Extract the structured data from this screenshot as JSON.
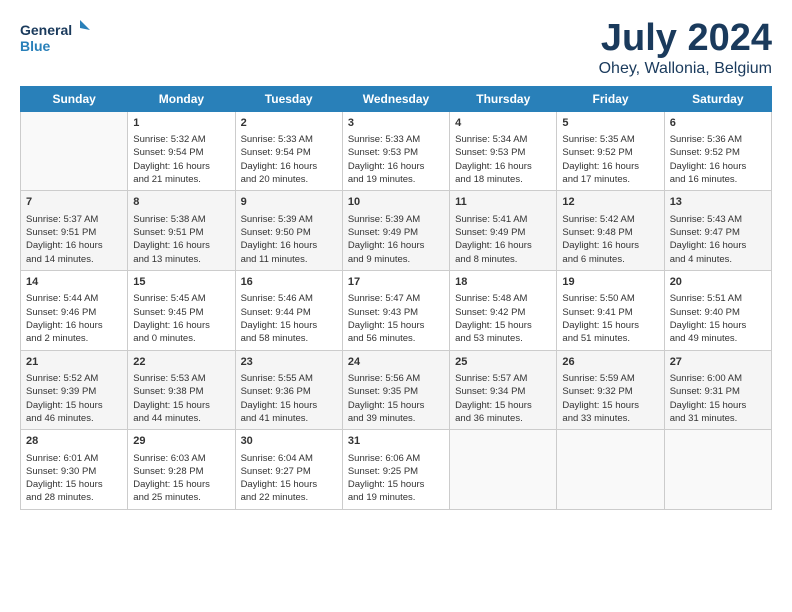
{
  "header": {
    "logo_line1": "General",
    "logo_line2": "Blue",
    "title": "July 2024",
    "subtitle": "Ohey, Wallonia, Belgium"
  },
  "days_of_week": [
    "Sunday",
    "Monday",
    "Tuesday",
    "Wednesday",
    "Thursday",
    "Friday",
    "Saturday"
  ],
  "weeks": [
    [
      {
        "day": "",
        "info": ""
      },
      {
        "day": "1",
        "info": "Sunrise: 5:32 AM\nSunset: 9:54 PM\nDaylight: 16 hours\nand 21 minutes."
      },
      {
        "day": "2",
        "info": "Sunrise: 5:33 AM\nSunset: 9:54 PM\nDaylight: 16 hours\nand 20 minutes."
      },
      {
        "day": "3",
        "info": "Sunrise: 5:33 AM\nSunset: 9:53 PM\nDaylight: 16 hours\nand 19 minutes."
      },
      {
        "day": "4",
        "info": "Sunrise: 5:34 AM\nSunset: 9:53 PM\nDaylight: 16 hours\nand 18 minutes."
      },
      {
        "day": "5",
        "info": "Sunrise: 5:35 AM\nSunset: 9:52 PM\nDaylight: 16 hours\nand 17 minutes."
      },
      {
        "day": "6",
        "info": "Sunrise: 5:36 AM\nSunset: 9:52 PM\nDaylight: 16 hours\nand 16 minutes."
      }
    ],
    [
      {
        "day": "7",
        "info": "Sunrise: 5:37 AM\nSunset: 9:51 PM\nDaylight: 16 hours\nand 14 minutes."
      },
      {
        "day": "8",
        "info": "Sunrise: 5:38 AM\nSunset: 9:51 PM\nDaylight: 16 hours\nand 13 minutes."
      },
      {
        "day": "9",
        "info": "Sunrise: 5:39 AM\nSunset: 9:50 PM\nDaylight: 16 hours\nand 11 minutes."
      },
      {
        "day": "10",
        "info": "Sunrise: 5:39 AM\nSunset: 9:49 PM\nDaylight: 16 hours\nand 9 minutes."
      },
      {
        "day": "11",
        "info": "Sunrise: 5:41 AM\nSunset: 9:49 PM\nDaylight: 16 hours\nand 8 minutes."
      },
      {
        "day": "12",
        "info": "Sunrise: 5:42 AM\nSunset: 9:48 PM\nDaylight: 16 hours\nand 6 minutes."
      },
      {
        "day": "13",
        "info": "Sunrise: 5:43 AM\nSunset: 9:47 PM\nDaylight: 16 hours\nand 4 minutes."
      }
    ],
    [
      {
        "day": "14",
        "info": "Sunrise: 5:44 AM\nSunset: 9:46 PM\nDaylight: 16 hours\nand 2 minutes."
      },
      {
        "day": "15",
        "info": "Sunrise: 5:45 AM\nSunset: 9:45 PM\nDaylight: 16 hours\nand 0 minutes."
      },
      {
        "day": "16",
        "info": "Sunrise: 5:46 AM\nSunset: 9:44 PM\nDaylight: 15 hours\nand 58 minutes."
      },
      {
        "day": "17",
        "info": "Sunrise: 5:47 AM\nSunset: 9:43 PM\nDaylight: 15 hours\nand 56 minutes."
      },
      {
        "day": "18",
        "info": "Sunrise: 5:48 AM\nSunset: 9:42 PM\nDaylight: 15 hours\nand 53 minutes."
      },
      {
        "day": "19",
        "info": "Sunrise: 5:50 AM\nSunset: 9:41 PM\nDaylight: 15 hours\nand 51 minutes."
      },
      {
        "day": "20",
        "info": "Sunrise: 5:51 AM\nSunset: 9:40 PM\nDaylight: 15 hours\nand 49 minutes."
      }
    ],
    [
      {
        "day": "21",
        "info": "Sunrise: 5:52 AM\nSunset: 9:39 PM\nDaylight: 15 hours\nand 46 minutes."
      },
      {
        "day": "22",
        "info": "Sunrise: 5:53 AM\nSunset: 9:38 PM\nDaylight: 15 hours\nand 44 minutes."
      },
      {
        "day": "23",
        "info": "Sunrise: 5:55 AM\nSunset: 9:36 PM\nDaylight: 15 hours\nand 41 minutes."
      },
      {
        "day": "24",
        "info": "Sunrise: 5:56 AM\nSunset: 9:35 PM\nDaylight: 15 hours\nand 39 minutes."
      },
      {
        "day": "25",
        "info": "Sunrise: 5:57 AM\nSunset: 9:34 PM\nDaylight: 15 hours\nand 36 minutes."
      },
      {
        "day": "26",
        "info": "Sunrise: 5:59 AM\nSunset: 9:32 PM\nDaylight: 15 hours\nand 33 minutes."
      },
      {
        "day": "27",
        "info": "Sunrise: 6:00 AM\nSunset: 9:31 PM\nDaylight: 15 hours\nand 31 minutes."
      }
    ],
    [
      {
        "day": "28",
        "info": "Sunrise: 6:01 AM\nSunset: 9:30 PM\nDaylight: 15 hours\nand 28 minutes."
      },
      {
        "day": "29",
        "info": "Sunrise: 6:03 AM\nSunset: 9:28 PM\nDaylight: 15 hours\nand 25 minutes."
      },
      {
        "day": "30",
        "info": "Sunrise: 6:04 AM\nSunset: 9:27 PM\nDaylight: 15 hours\nand 22 minutes."
      },
      {
        "day": "31",
        "info": "Sunrise: 6:06 AM\nSunset: 9:25 PM\nDaylight: 15 hours\nand 19 minutes."
      },
      {
        "day": "",
        "info": ""
      },
      {
        "day": "",
        "info": ""
      },
      {
        "day": "",
        "info": ""
      }
    ]
  ]
}
